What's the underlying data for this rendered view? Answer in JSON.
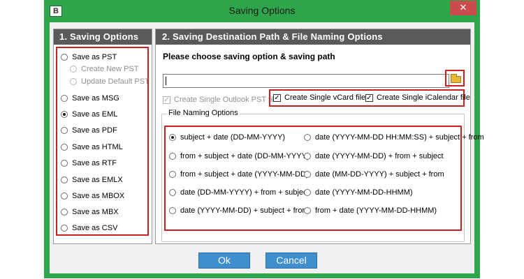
{
  "window": {
    "title": "Saving Options",
    "app_icon_text": "B",
    "close_glyph": "✕"
  },
  "left": {
    "header": "1. Saving Options",
    "options": [
      {
        "label": "Save as PST",
        "checked": false
      },
      {
        "label": "Create New PST",
        "disabled": true,
        "sub": true
      },
      {
        "label": "Update Default PST",
        "disabled": true,
        "sub": true
      },
      {
        "label": "Save as MSG",
        "checked": false
      },
      {
        "label": "Save as EML",
        "checked": true
      },
      {
        "label": "Save as PDF",
        "checked": false
      },
      {
        "label": "Save as HTML",
        "checked": false
      },
      {
        "label": "Save as RTF",
        "checked": false
      },
      {
        "label": "Save as EMLX",
        "checked": false
      },
      {
        "label": "Save as MBOX",
        "checked": false
      },
      {
        "label": "Save as MBX",
        "checked": false
      },
      {
        "label": "Save as CSV",
        "checked": false
      }
    ]
  },
  "right": {
    "header": "2. Saving Destination Path & File Naming Options",
    "prompt": "Please choose saving option & saving path",
    "path_value": "",
    "browse_icon": "folder-icon",
    "checks": {
      "single_pst": {
        "label": "Create Single Outlook PST file",
        "checked": true,
        "disabled": true
      },
      "single_vcard": {
        "label": "Create Single vCard file",
        "checked": true
      },
      "single_ical": {
        "label": "Create Single iCalendar file",
        "checked": true
      }
    },
    "naming_legend": "File Naming Options",
    "naming_left": [
      {
        "label": "subject + date (DD-MM-YYYY)",
        "checked": true
      },
      {
        "label": "from + subject + date (DD-MM-YYYY)",
        "checked": false
      },
      {
        "label": "from + subject + date (YYYY-MM-DD)",
        "checked": false
      },
      {
        "label": "date (DD-MM-YYYY) + from + subject",
        "checked": false
      },
      {
        "label": "date (YYYY-MM-DD) + subject + from",
        "checked": false
      }
    ],
    "naming_right": [
      {
        "label": "date (YYYY-MM-DD HH:MM:SS) + subject + from",
        "checked": false
      },
      {
        "label": "date (YYYY-MM-DD) + from + subject",
        "checked": false
      },
      {
        "label": "date (MM-DD-YYYY) + subject + from",
        "checked": false
      },
      {
        "label": "date (YYYY-MM-DD-HHMM)",
        "checked": false
      },
      {
        "label": "from + date (YYYY-MM-DD-HHMM)",
        "checked": false
      }
    ]
  },
  "buttons": {
    "ok": "Ok",
    "cancel": "Cancel"
  },
  "colors": {
    "title_bar": "#2ea44b",
    "header_bg": "#5a5a5a",
    "highlight_box": "#cc1f1f",
    "button": "#3f8fcf"
  }
}
